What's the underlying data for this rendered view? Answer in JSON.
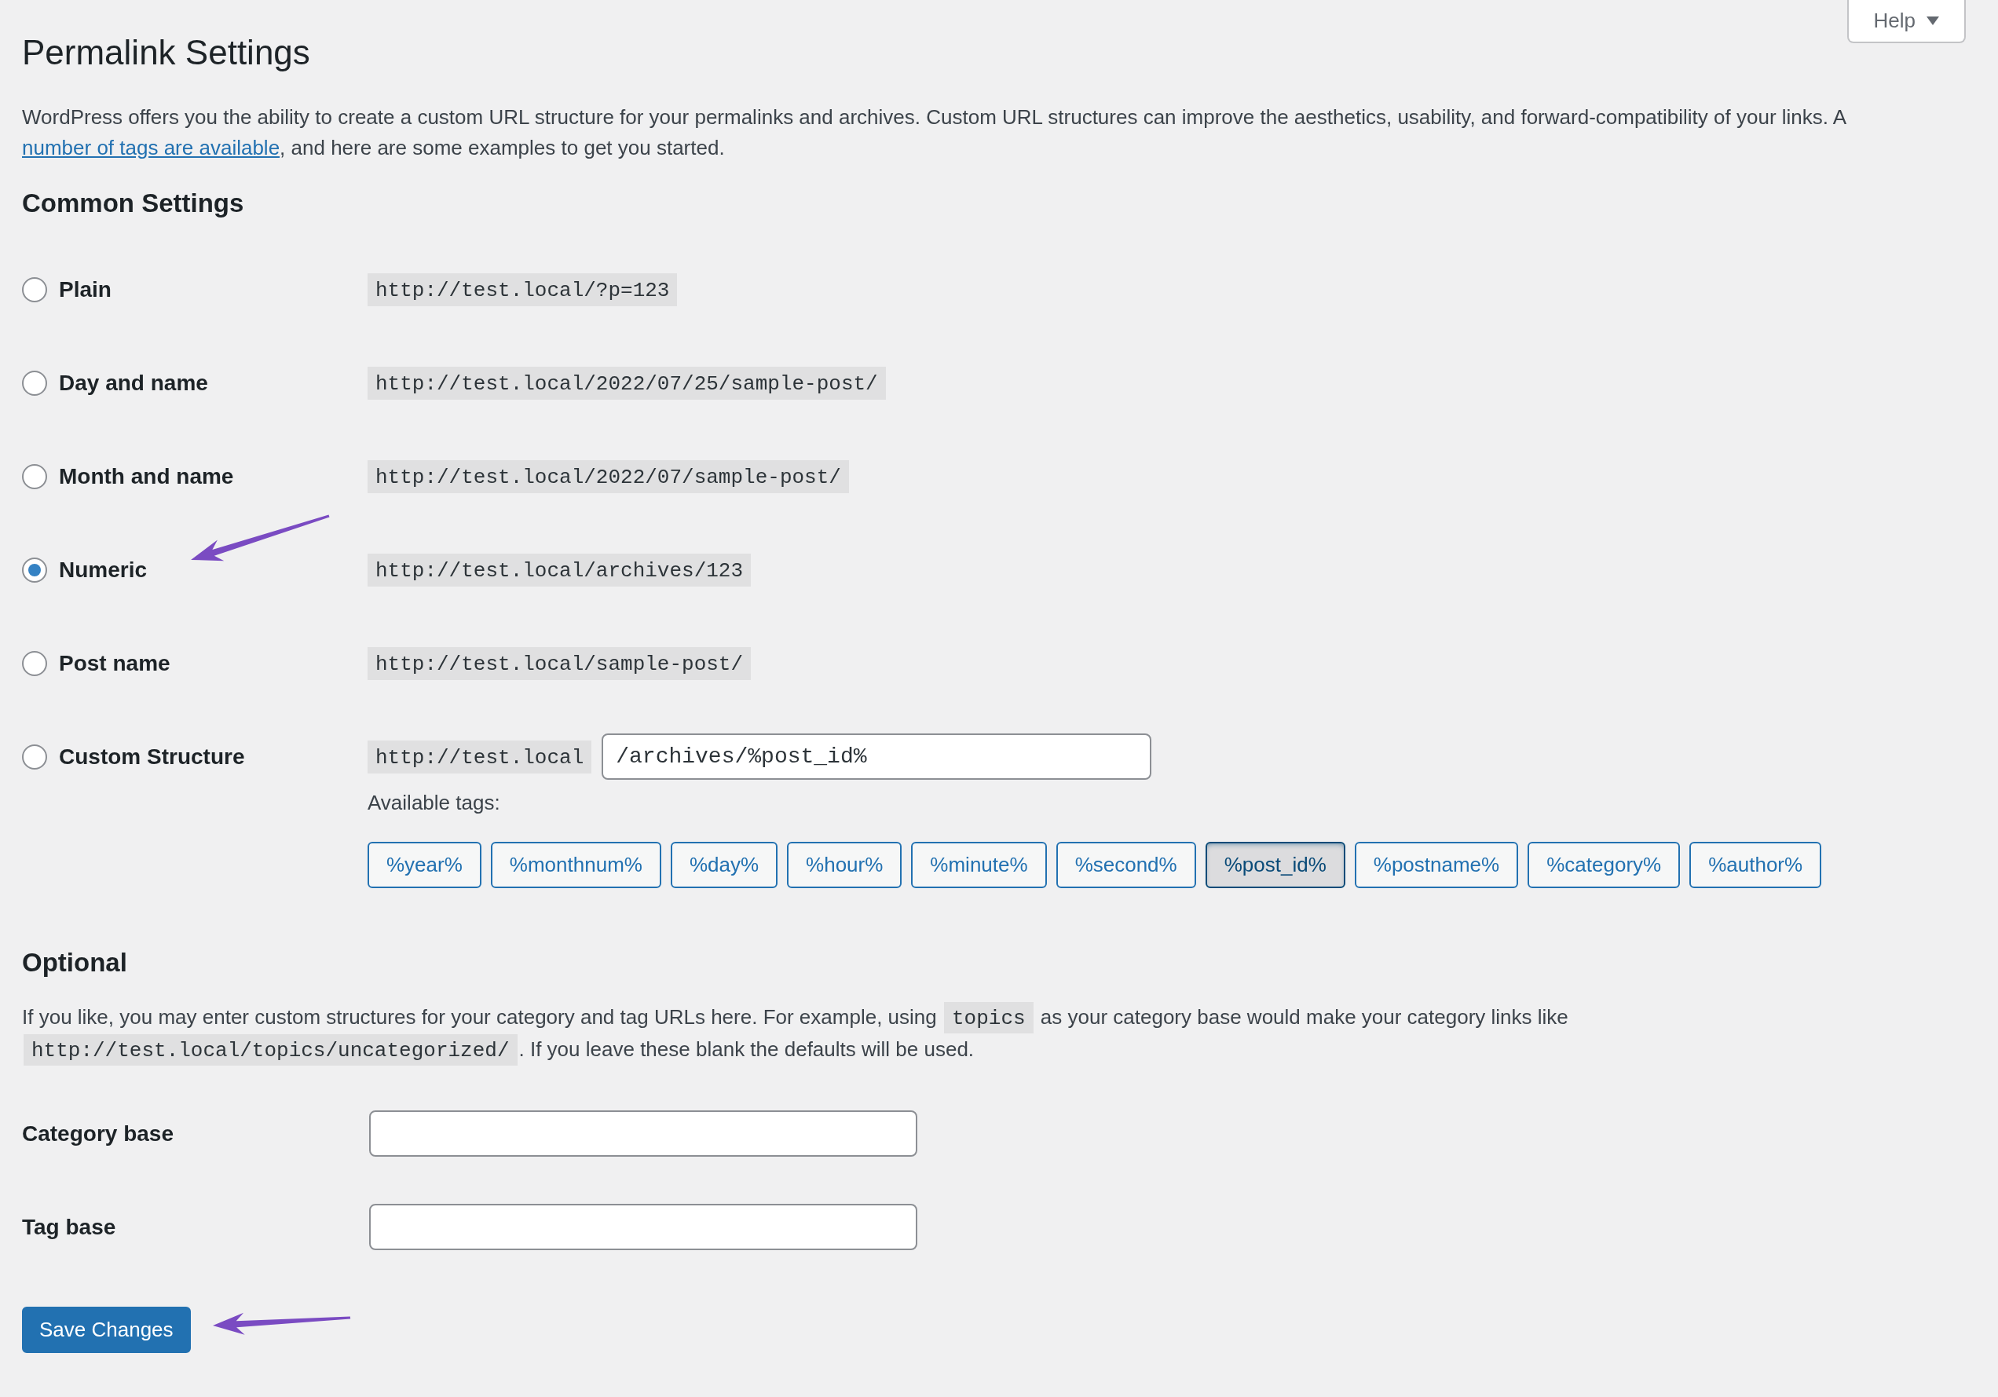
{
  "help_button": {
    "label": "Help"
  },
  "page_title": "Permalink Settings",
  "intro": {
    "parts": [
      {
        "kind": "text",
        "text": "WordPress offers you the ability to create a custom URL structure for your permalinks and archives. Custom URL structures can improve the aesthetics, usability, and forward-compatibility of your links. A "
      },
      {
        "kind": "link",
        "text": "number of tags are available"
      },
      {
        "kind": "text",
        "text": ", and here are some examples to get you started."
      }
    ]
  },
  "common_settings": {
    "heading": "Common Settings",
    "options": [
      {
        "kind": "preset",
        "label": "Plain",
        "example": "http://test.local/?p=123",
        "selected": false,
        "arrow": false
      },
      {
        "kind": "preset",
        "label": "Day and name",
        "example": "http://test.local/2022/07/25/sample-post/",
        "selected": false,
        "arrow": false
      },
      {
        "kind": "preset",
        "label": "Month and name",
        "example": "http://test.local/2022/07/sample-post/",
        "selected": false,
        "arrow": false
      },
      {
        "kind": "preset",
        "label": "Numeric",
        "example": "http://test.local/archives/123",
        "selected": true,
        "arrow": true
      },
      {
        "kind": "preset",
        "label": "Post name",
        "example": "http://test.local/sample-post/",
        "selected": false,
        "arrow": false
      },
      {
        "kind": "custom",
        "label": "Custom Structure",
        "prefix": "http://test.local",
        "value": "/archives/%post_id%",
        "selected": false,
        "arrow": false,
        "tags_label": "Available tags:",
        "tags": [
          {
            "label": "%year%",
            "selected": false
          },
          {
            "label": "%monthnum%",
            "selected": false
          },
          {
            "label": "%day%",
            "selected": false
          },
          {
            "label": "%hour%",
            "selected": false
          },
          {
            "label": "%minute%",
            "selected": false
          },
          {
            "label": "%second%",
            "selected": false
          },
          {
            "label": "%post_id%",
            "selected": true
          },
          {
            "label": "%postname%",
            "selected": false
          },
          {
            "label": "%category%",
            "selected": false
          },
          {
            "label": "%author%",
            "selected": false
          }
        ]
      }
    ]
  },
  "optional": {
    "heading": "Optional",
    "description": {
      "parts": [
        {
          "kind": "text",
          "text": "If you like, you may enter custom structures for your category and tag URLs here. For example, using "
        },
        {
          "kind": "code",
          "text": "topics"
        },
        {
          "kind": "text",
          "text": " as your category base would make your category links like "
        },
        {
          "kind": "code",
          "text": "http://test.local/topics/uncategorized/"
        },
        {
          "kind": "text",
          "text": ". If you leave these blank the defaults will be used."
        }
      ]
    },
    "fields": [
      {
        "label": "Category base"
      },
      {
        "label": "Tag base"
      }
    ]
  },
  "save_button": {
    "label": "Save Changes",
    "arrow": true
  }
}
